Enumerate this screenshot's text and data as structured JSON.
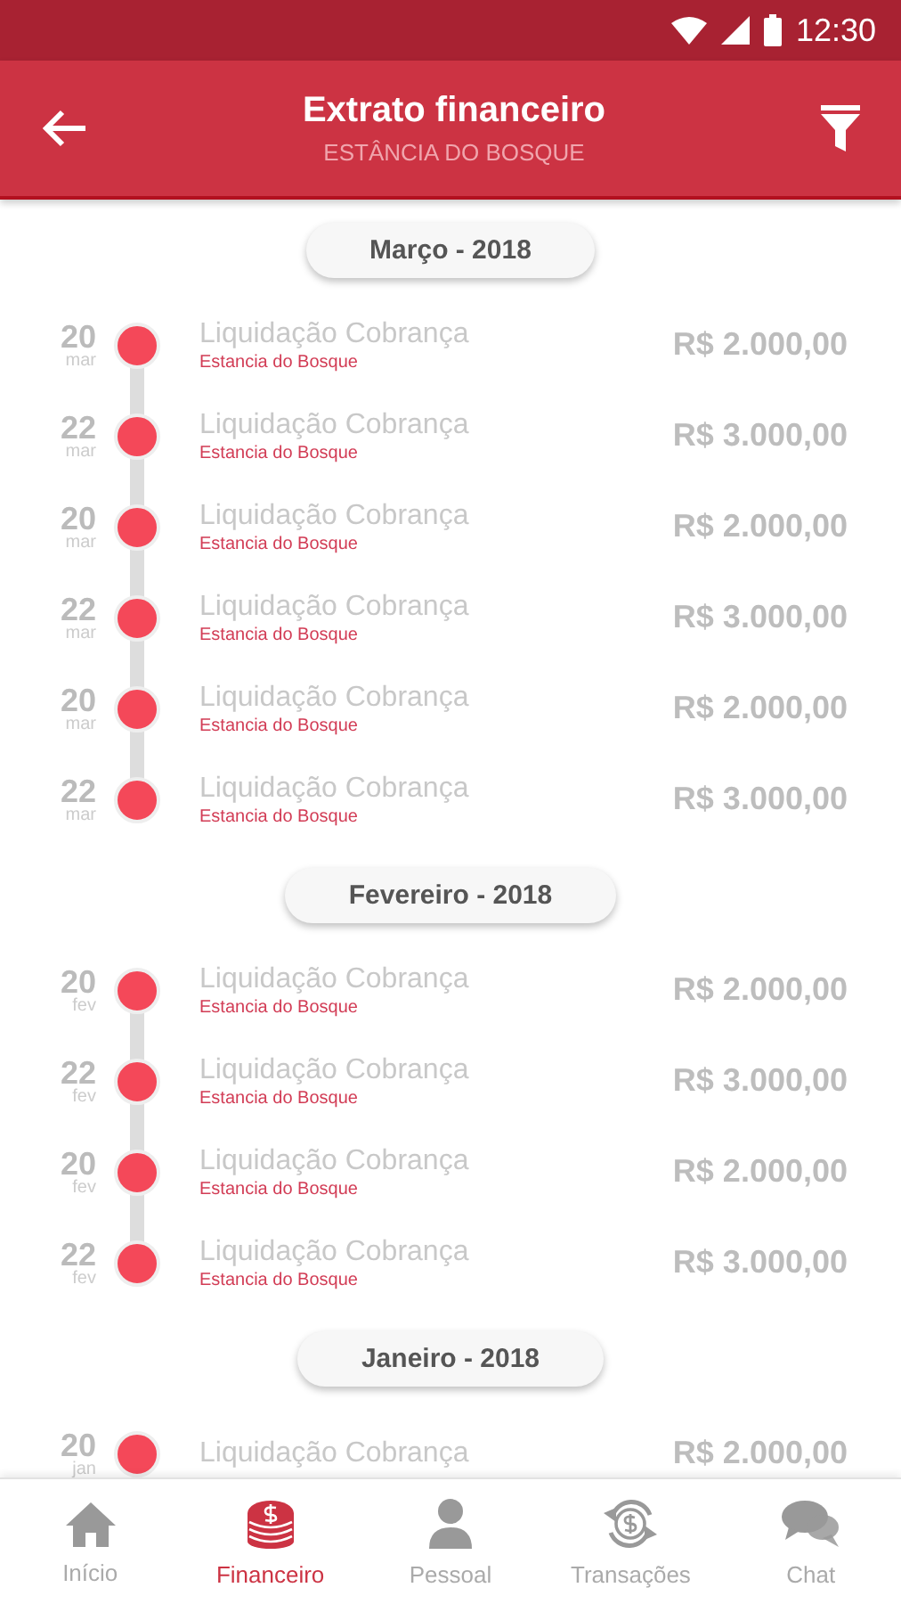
{
  "status_bar": {
    "time": "12:30"
  },
  "app_bar": {
    "title": "Extrato financeiro",
    "subtitle": "ESTÂNCIA DO BOSQUE"
  },
  "sections": [
    {
      "header": "Março - 2018",
      "entries": [
        {
          "day": "20",
          "month": "mar",
          "title": "Liquidação Cobrança",
          "subtitle": "Estancia do Bosque",
          "amount": "R$ 2.000,00"
        },
        {
          "day": "22",
          "month": "mar",
          "title": "Liquidação Cobrança",
          "subtitle": "Estancia do Bosque",
          "amount": "R$ 3.000,00"
        },
        {
          "day": "20",
          "month": "mar",
          "title": "Liquidação Cobrança",
          "subtitle": "Estancia do Bosque",
          "amount": "R$ 2.000,00"
        },
        {
          "day": "22",
          "month": "mar",
          "title": "Liquidação Cobrança",
          "subtitle": "Estancia do Bosque",
          "amount": "R$ 3.000,00"
        },
        {
          "day": "20",
          "month": "mar",
          "title": "Liquidação Cobrança",
          "subtitle": "Estancia do Bosque",
          "amount": "R$ 2.000,00"
        },
        {
          "day": "22",
          "month": "mar",
          "title": "Liquidação Cobrança",
          "subtitle": "Estancia do Bosque",
          "amount": "R$ 3.000,00"
        }
      ]
    },
    {
      "header": "Fevereiro - 2018",
      "entries": [
        {
          "day": "20",
          "month": "fev",
          "title": "Liquidação Cobrança",
          "subtitle": "Estancia do Bosque",
          "amount": "R$ 2.000,00"
        },
        {
          "day": "22",
          "month": "fev",
          "title": "Liquidação Cobrança",
          "subtitle": "Estancia do Bosque",
          "amount": "R$ 3.000,00"
        },
        {
          "day": "20",
          "month": "fev",
          "title": "Liquidação Cobrança",
          "subtitle": "Estancia do Bosque",
          "amount": "R$ 2.000,00"
        },
        {
          "day": "22",
          "month": "fev",
          "title": "Liquidação Cobrança",
          "subtitle": "Estancia do Bosque",
          "amount": "R$ 3.000,00"
        }
      ]
    },
    {
      "header": "Janeiro - 2018",
      "entries": [
        {
          "day": "20",
          "month": "jan",
          "title": "Liquidação Cobrança",
          "amount": "R$ 2.000,00"
        }
      ]
    }
  ],
  "bottom_nav": [
    {
      "kind": "home",
      "label": "Início",
      "selected": false
    },
    {
      "kind": "coins",
      "label": "Financeiro",
      "selected": true
    },
    {
      "kind": "person",
      "label": "Pessoal",
      "selected": false
    },
    {
      "kind": "exchange",
      "label": "Transações",
      "selected": false
    },
    {
      "kind": "chat",
      "label": "Chat",
      "selected": false
    }
  ]
}
